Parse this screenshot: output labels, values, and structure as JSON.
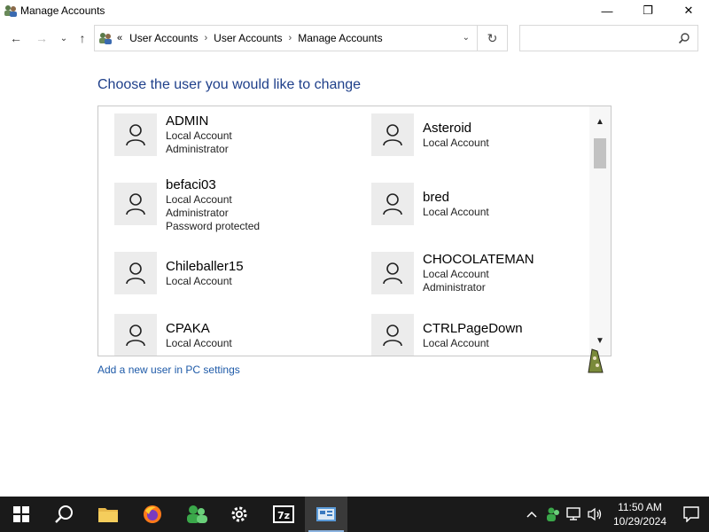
{
  "window": {
    "title": "Manage Accounts",
    "minimize_glyph": "—",
    "maximize_glyph": "❐",
    "close_glyph": "✕"
  },
  "nav": {
    "back_glyph": "←",
    "forward_glyph": "→",
    "recent_glyph": "⌄",
    "up_glyph": "↑",
    "overflow": "«",
    "breadcrumb": [
      "User Accounts",
      "User Accounts",
      "Manage Accounts"
    ],
    "separator": "›",
    "dropdown_glyph": "⌄",
    "refresh_glyph": "↻",
    "search_placeholder": ""
  },
  "content": {
    "heading": "Choose the user you would like to change",
    "add_user_link": "Add a new user in PC settings",
    "scroll_up_glyph": "▲",
    "scroll_down_glyph": "▼",
    "users": [
      {
        "name": "ADMIN",
        "lines": [
          "Local Account",
          "Administrator"
        ]
      },
      {
        "name": "Asteroid",
        "lines": [
          "Local Account"
        ]
      },
      {
        "name": "befaci03",
        "lines": [
          "Local Account",
          "Administrator",
          "Password protected"
        ]
      },
      {
        "name": "bred",
        "lines": [
          "Local Account"
        ]
      },
      {
        "name": "Chileballer15",
        "lines": [
          "Local Account"
        ]
      },
      {
        "name": "CHOCOLATEMAN",
        "lines": [
          "Local Account",
          "Administrator"
        ]
      },
      {
        "name": "CPAKA",
        "lines": [
          "Local Account"
        ]
      },
      {
        "name": "CTRLPageDown",
        "lines": [
          "Local Account"
        ]
      }
    ]
  },
  "taskbar": {
    "apps": [
      "start",
      "search",
      "file-explorer",
      "firefox",
      "people",
      "settings",
      "7-zip",
      "control-panel"
    ],
    "time": "11:50 AM",
    "date": "10/29/2024"
  },
  "colors": {
    "heading": "#1e3f8a",
    "link": "#1e5aa8",
    "taskbar": "#1a1a1a",
    "avatar_bg": "#ececec"
  }
}
